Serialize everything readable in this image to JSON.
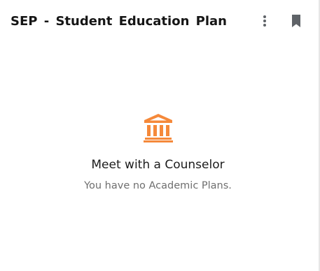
{
  "card": {
    "title": "SEP - Student Education Plan",
    "actions": {
      "more_icon": "more-vertical-icon",
      "bookmark_icon": "bookmark-icon"
    }
  },
  "empty_state": {
    "icon": "bank-icon",
    "title": "Meet with a Counselor",
    "subtitle": "You have no Academic Plans."
  },
  "colors": {
    "accent": "#f5893a",
    "title_text": "#151515",
    "subtitle_text": "#6f6f6f",
    "icon_gray": "#5f6368"
  }
}
